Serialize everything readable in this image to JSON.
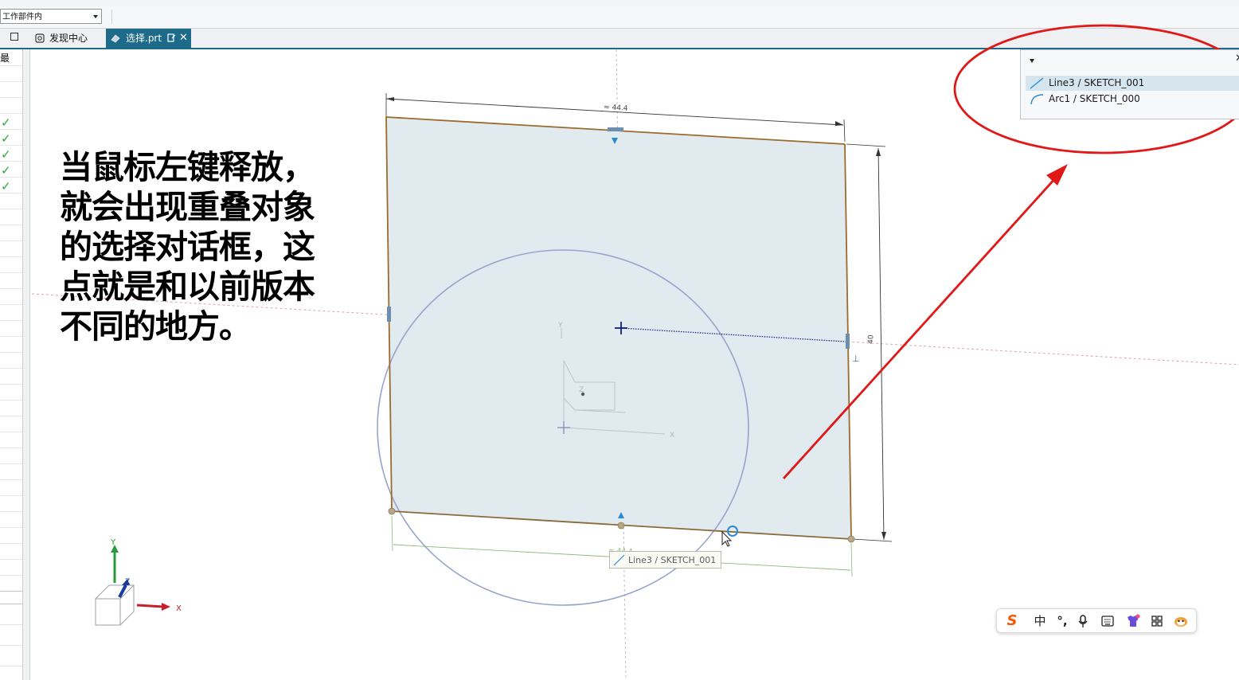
{
  "toolbar": {
    "filter_value": "工作部件内"
  },
  "tabs": [
    {
      "label": "发现中心",
      "icon": "discovery-icon"
    },
    {
      "label": "选择.prt",
      "icon": "part-file-icon",
      "active": true
    }
  ],
  "left_panel": {
    "header": "最"
  },
  "annotation": {
    "lines": [
      "当鼠标左键释放，",
      "就会出现重叠对象",
      "的选择对话框，这",
      "点就是和以前版本",
      "不同的地方。"
    ]
  },
  "quickpick": {
    "items": [
      {
        "label": "Line3 / SKETCH_001",
        "icon": "line-icon",
        "selected": true
      },
      {
        "label": "Arc1 / SKETCH_000",
        "icon": "arc-icon",
        "selected": false
      }
    ]
  },
  "canvas": {
    "dim_top": "≈ 44.4",
    "dim_right": "40",
    "dim_bottom": "≈ 44.4",
    "tooltip": "Line3 / SKETCH_001",
    "axis_x": "X",
    "axis_y": "Y",
    "axis_z": "Z",
    "triad_x": "X",
    "triad_y": "Y",
    "triad_z": "Z"
  },
  "ime_toolbar": {
    "items": [
      {
        "label": "S",
        "icon": "sogou-logo-icon"
      },
      {
        "label": "中",
        "icon": "chinese-mode-icon"
      },
      {
        "label": "°,",
        "icon": "punctuation-icon"
      },
      {
        "label": "",
        "icon": "microphone-icon"
      },
      {
        "label": "",
        "icon": "keyboard-icon"
      },
      {
        "label": "",
        "icon": "skin-icon"
      },
      {
        "label": "",
        "icon": "apps-grid-icon"
      },
      {
        "label": "",
        "icon": "mascot-icon"
      }
    ]
  },
  "colors": {
    "accent_tab": "#1d6b89",
    "sketch_face": "#e1eaee",
    "sketch_edge": "#9a6b2c",
    "arrow_red": "#e01818",
    "ellipse_red": "#e01818",
    "circle": "#97a4ce",
    "check_green": "#2aa836"
  }
}
